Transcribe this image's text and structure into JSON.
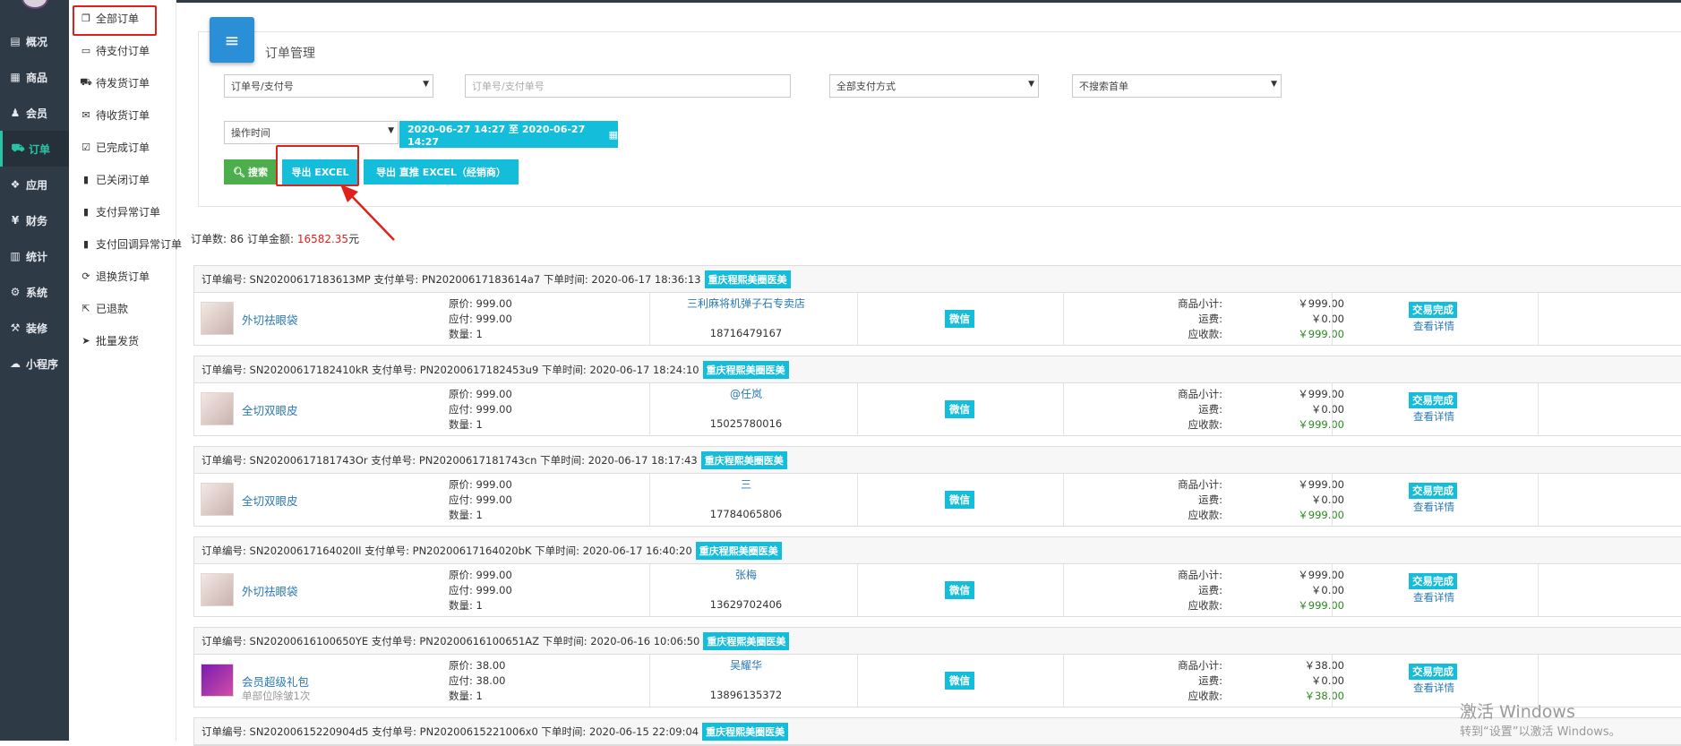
{
  "sidebar_main": {
    "items": [
      {
        "label": "概况",
        "icon": "dashboard-icon"
      },
      {
        "label": "商品",
        "icon": "goods-icon"
      },
      {
        "label": "会员",
        "icon": "members-icon"
      },
      {
        "label": "订单",
        "icon": "cart-icon",
        "active": true
      },
      {
        "label": "应用",
        "icon": "apps-icon"
      },
      {
        "label": "财务",
        "icon": "yen-icon"
      },
      {
        "label": "统计",
        "icon": "chart-icon"
      },
      {
        "label": "系统",
        "icon": "gears-icon"
      },
      {
        "label": "装修",
        "icon": "hammer-icon"
      },
      {
        "label": "小程序",
        "icon": "wechat-icon"
      }
    ]
  },
  "sidebar_sub": {
    "items": [
      {
        "label": "全部订单",
        "icon": "copy-icon",
        "active": true
      },
      {
        "label": "待支付订单",
        "icon": "card-icon"
      },
      {
        "label": "待发货订单",
        "icon": "truck-icon"
      },
      {
        "label": "待收货订单",
        "icon": "gift-icon"
      },
      {
        "label": "已完成订单",
        "icon": "check-square-icon"
      },
      {
        "label": "已关闭订单",
        "icon": "trash-icon"
      },
      {
        "label": "支付异常订单",
        "icon": "trash-icon"
      },
      {
        "label": "支付回调异常订单",
        "icon": "trash-icon"
      },
      {
        "label": "退换货订单",
        "icon": "refresh-icon"
      },
      {
        "label": "已退款",
        "icon": "share-icon"
      },
      {
        "label": "批量发货",
        "icon": "send-icon"
      }
    ]
  },
  "panel": {
    "title": "订单管理",
    "filter_type": "订单号/支付号",
    "search_placeholder": "订单号/支付单号",
    "pay_method": "全部支付方式",
    "first_order": "不搜索首单",
    "time_type": "操作时间",
    "date_range": "2020-06-27 14:27 至 2020-06-27 14:27",
    "search_btn": "搜索",
    "export_btn": "导出 EXCEL",
    "export_direct_btn": "导出 直推 EXCEL（经销商）"
  },
  "summary": {
    "prefix": "订单数: 86 订单金额: ",
    "amount": "16582.35",
    "suffix": "元"
  },
  "labels": {
    "original": "原价: ",
    "payable": "应付: ",
    "qty": "数量: ",
    "subtotal": "商品小计:",
    "freight": "运费:",
    "receivable": "应收款:",
    "done": "交易完成",
    "detail": "查看详情"
  },
  "orders": [
    {
      "head": "订单编号: SN20200617183613MP 支付单号: PN20200617183614a7 下单时间: 2020-06-17 18:36:13",
      "tag": "重庆程熙美圈医美",
      "product": "外切祛眼袋",
      "sub": "",
      "thumb": "face",
      "original": "999.00",
      "payable": "999.00",
      "qty": "1",
      "buyer": "三利麻将机弹子石专卖店",
      "phone": "18716479167",
      "pay": "微信",
      "subtotal": "￥999.00",
      "freight": "￥0.00",
      "receivable": "￥999.00"
    },
    {
      "head": "订单编号: SN20200617182410kR 支付单号: PN20200617182453u9 下单时间: 2020-06-17 18:24:10",
      "tag": "重庆程熙美圈医美",
      "product": "全切双眼皮",
      "sub": "",
      "thumb": "face",
      "original": "999.00",
      "payable": "999.00",
      "qty": "1",
      "buyer": "@任岚",
      "phone": "15025780016",
      "pay": "微信",
      "subtotal": "￥999.00",
      "freight": "￥0.00",
      "receivable": "￥999.00"
    },
    {
      "head": "订单编号: SN20200617181743Or 支付单号: PN20200617181743cn 下单时间: 2020-06-17 18:17:43",
      "tag": "重庆程熙美圈医美",
      "product": "全切双眼皮",
      "sub": "",
      "thumb": "face",
      "original": "999.00",
      "payable": "999.00",
      "qty": "1",
      "buyer": "三",
      "phone": "17784065806",
      "pay": "微信",
      "subtotal": "￥999.00",
      "freight": "￥0.00",
      "receivable": "￥999.00"
    },
    {
      "head": "订单编号: SN20200617164020Il 支付单号: PN20200617164020bK 下单时间: 2020-06-17 16:40:20",
      "tag": "重庆程熙美圈医美",
      "product": "外切祛眼袋",
      "sub": "",
      "thumb": "face",
      "original": "999.00",
      "payable": "999.00",
      "qty": "1",
      "buyer": "张梅",
      "phone": "13629702406",
      "pay": "微信",
      "subtotal": "￥999.00",
      "freight": "￥0.00",
      "receivable": "￥999.00"
    },
    {
      "head": "订单编号: SN20200616100650YE 支付单号: PN20200616100651AZ 下单时间: 2020-06-16 10:06:50",
      "tag": "重庆程熙美圈医美",
      "product": "会员超级礼包",
      "sub": "单部位除皱1次",
      "thumb": "gift",
      "original": "38.00",
      "payable": "38.00",
      "qty": "1",
      "buyer": "吴耀华",
      "phone": "13896135372",
      "pay": "微信",
      "subtotal": "￥38.00",
      "freight": "￥0.00",
      "receivable": "￥38.00"
    },
    {
      "head": "订单编号: SN20200615220904d5 支付单号: PN20200615221006x0 下单时间: 2020-06-15 22:09:04",
      "tag": "重庆程熙美圈医美"
    }
  ],
  "watermark": {
    "line1": "激活 Windows",
    "line2": "转到“设置”以激活 Windows。"
  }
}
